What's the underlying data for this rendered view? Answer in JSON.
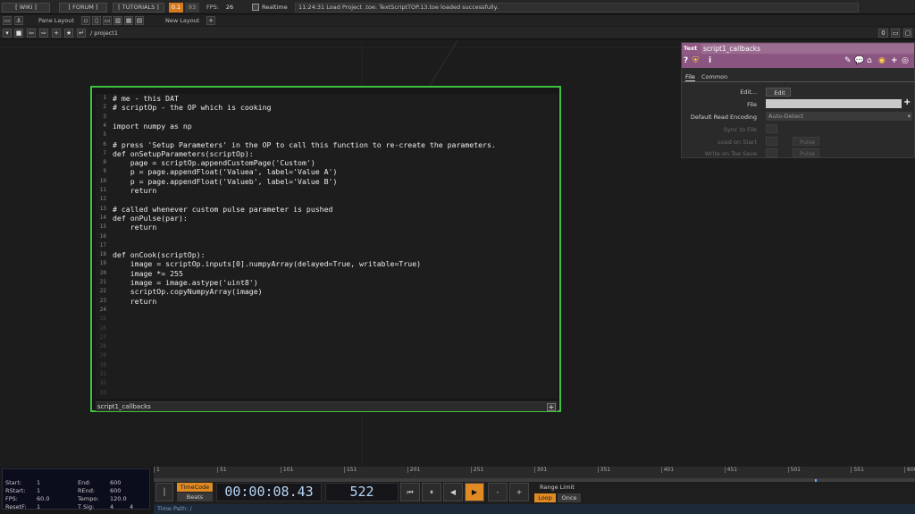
{
  "topbar": {
    "wiki": "[ WIKI ]",
    "forum": "[ FORUM ]",
    "tutorials": "[ TUTORIALS ]",
    "perf_a": "0.1",
    "perf_b": "93",
    "fps_label": "FPS:",
    "fps_value": "26",
    "realtime": "Realtime",
    "status_message": "11:24:31 Load Project .toe: TextScriptTOP.13.toe loaded successfully."
  },
  "secondbar": {
    "pane_layout": "Pane Layout",
    "new_layout": "New Layout"
  },
  "pathbar": {
    "path": "/ project1",
    "pane_index": "0"
  },
  "editor": {
    "footer_label": "script1_callbacks",
    "lines": [
      {
        "n": "1",
        "t": "# me - this DAT"
      },
      {
        "n": "2",
        "t": "# scriptOp - the OP which is cooking"
      },
      {
        "n": "3",
        "t": ""
      },
      {
        "n": "4",
        "t": "import numpy as np"
      },
      {
        "n": "5",
        "t": ""
      },
      {
        "n": "6",
        "t": "# press 'Setup Parameters' in the OP to call this function to re-create the parameters."
      },
      {
        "n": "7",
        "t": "def onSetupParameters(scriptOp):"
      },
      {
        "n": "8",
        "t": "    page = scriptOp.appendCustomPage('Custom')"
      },
      {
        "n": "9",
        "t": "    p = page.appendFloat('Valuea', label='Value A')"
      },
      {
        "n": "10",
        "t": "    p = page.appendFloat('Valueb', label='Value B')"
      },
      {
        "n": "11",
        "t": "    return"
      },
      {
        "n": "12",
        "t": ""
      },
      {
        "n": "13",
        "t": "# called whenever custom pulse parameter is pushed"
      },
      {
        "n": "14",
        "t": "def onPulse(par):"
      },
      {
        "n": "15",
        "t": "    return"
      },
      {
        "n": "16",
        "t": ""
      },
      {
        "n": "17",
        "t": ""
      },
      {
        "n": "18",
        "t": "def onCook(scriptOp):"
      },
      {
        "n": "19",
        "t": "    image = scriptOp.inputs[0].numpyArray(delayed=True, writable=True)"
      },
      {
        "n": "20",
        "t": "    image *= 255"
      },
      {
        "n": "21",
        "t": "    image = image.astype('uint8')"
      },
      {
        "n": "22",
        "t": "    scriptOp.copyNumpyArray(image)"
      },
      {
        "n": "23",
        "t": "    return"
      },
      {
        "n": "24",
        "t": ""
      },
      {
        "n": "25",
        "t": ""
      },
      {
        "n": "26",
        "t": ""
      },
      {
        "n": "27",
        "t": ""
      },
      {
        "n": "28",
        "t": ""
      },
      {
        "n": "29",
        "t": ""
      },
      {
        "n": "30",
        "t": ""
      },
      {
        "n": "31",
        "t": ""
      },
      {
        "n": "32",
        "t": ""
      },
      {
        "n": "33",
        "t": ""
      }
    ]
  },
  "params": {
    "type_label": "Text",
    "name": "script1_callbacks",
    "tab_file": "File",
    "tab_common": "Common",
    "edit_label": "Edit...",
    "edit_button": "Edit",
    "file_label": "File",
    "encoding_label": "Default Read Encoding",
    "encoding_value": "Auto-Detect",
    "sync_label": "Sync to File",
    "load_label": "Load on Start",
    "load_button": "Pulse",
    "write_label": "Write on Toe Save",
    "write_button": "Pulse"
  },
  "bottom": {
    "info": {
      "start_label": "Start:",
      "start": "1",
      "end_label": "End:",
      "end": "600",
      "rstart_label": "RStart:",
      "rstart": "1",
      "rend_label": "REnd:",
      "rend": "600",
      "fps_label": "FPS:",
      "fps": "60.0",
      "tempo_label": "Tempo:",
      "tempo": "120.0",
      "resetf_label": "ResetF:",
      "resetf": "1",
      "tsig_label": "T Sig:",
      "tsig_a": "4",
      "tsig_b": "4"
    },
    "ticks": [
      "1",
      "51",
      "101",
      "151",
      "201",
      "251",
      "301",
      "351",
      "401",
      "451",
      "501",
      "551",
      "600"
    ],
    "timecode_button": "TimeCode",
    "beats_button": "Beats",
    "timecode": "00:00:08.43",
    "frame": "522",
    "range_limit": "Range Limit",
    "loop": "Loop",
    "once": "Once",
    "time_path": "Time Path: /"
  },
  "colors": {
    "editor_border": "#3fc13f",
    "param_header": "#8f5a83",
    "timecode_active": "#e08a24"
  }
}
